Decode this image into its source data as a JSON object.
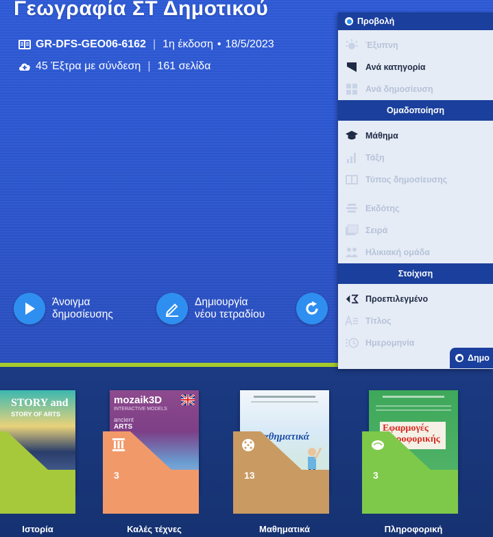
{
  "header": {
    "title": "Γεωγραφία ΣΤ Δημοτικού",
    "code": "GR-DFS-GEO06-6162",
    "edition": "1η έκδοση",
    "date": "18/5/2023",
    "extras": "45 Έξτρα με σύνδεση",
    "pages": "161 σελίδα",
    "separator": "|",
    "bullet": "•"
  },
  "actions": {
    "open_line1": "Άνοιγμα",
    "open_line2": "δημοσίευσης",
    "create_line1": "Δημιουργία",
    "create_line2": "νέου τετραδίου"
  },
  "panel": {
    "header": "Προβολή",
    "view_items": [
      {
        "label": "Έξυπνη",
        "icon": "bulb-icon",
        "active": false
      },
      {
        "label": "Ανά κατηγορία",
        "icon": "bookmark-icon",
        "active": true
      },
      {
        "label": "Ανά δημοσίευση",
        "icon": "grid-icon",
        "active": false
      }
    ],
    "group_title": "Ομαδοποίηση",
    "group_items": [
      {
        "label": "Μάθημα",
        "icon": "graduation-cap-icon",
        "active": true
      },
      {
        "label": "Τάξη",
        "icon": "bar-chart-icon",
        "active": false
      },
      {
        "label": "Τύπος δημοσίευσης",
        "icon": "book-icon",
        "active": false
      },
      {
        "label": "Εκδότης",
        "icon": "stack-icon",
        "active": false
      },
      {
        "label": "Σειρά",
        "icon": "books-icon",
        "active": false
      },
      {
        "label": "Ηλικιακή ομάδα",
        "icon": "people-icon",
        "active": false
      }
    ],
    "sort_title": "Στοίχιση",
    "sort_items": [
      {
        "label": "Προεπιλεγμένο",
        "icon": "sort-default-icon",
        "active": true
      },
      {
        "label": "Τίτλος",
        "icon": "sort-title-icon",
        "active": false
      },
      {
        "label": "Ημερομηνία",
        "icon": "sort-date-icon",
        "active": false
      }
    ],
    "bottom_tab": "Δημο"
  },
  "books": [
    {
      "label": "Ιστορία",
      "count": "",
      "cover_text": "STORY and",
      "cover_text2": "STORY OF ARTS",
      "color": "#a5c93a"
    },
    {
      "label": "Καλές τέχνες",
      "count": "3",
      "cover_text": "mozaik3D",
      "cover_text2": "INTERACTIVE MODELS",
      "cover_text3": "ancient",
      "cover_text4": "ARTS",
      "color": "#f2996a"
    },
    {
      "label": "Μαθηματικά",
      "count": "13",
      "cover_text": "Μαθηματικά",
      "color": "#c99a62"
    },
    {
      "label": "Πληροφορική",
      "count": "3",
      "cover_text": "Εφαρμογές",
      "cover_text2": "ροφορικής",
      "color": "#7ec94a"
    }
  ],
  "colors": {
    "hero_blue": "#2e5bd8",
    "panel_navy": "#1a3f9c",
    "accent_green": "#a6c92c",
    "button_blue": "#2f8ff0"
  }
}
